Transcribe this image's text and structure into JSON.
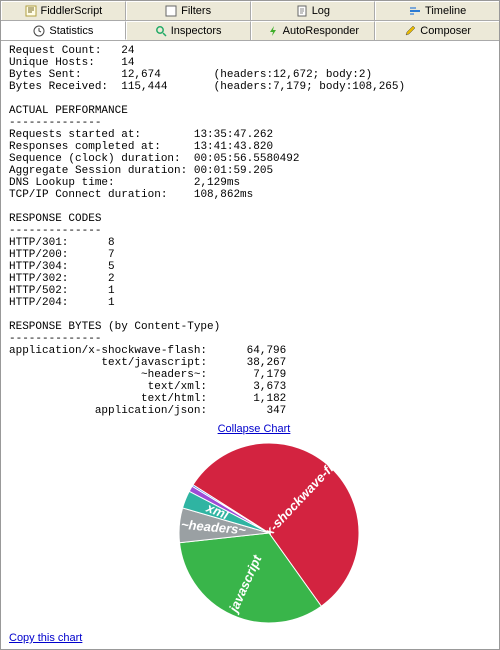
{
  "tabsTop": {
    "t0": "FiddlerScript",
    "t1": "Filters",
    "t2": "Log",
    "t3": "Timeline"
  },
  "tabsBottom": {
    "t0": "Statistics",
    "t1": "Inspectors",
    "t2": "AutoResponder",
    "t3": "Composer"
  },
  "summary": {
    "request_count_label": "Request Count:",
    "request_count": "24",
    "unique_hosts_label": "Unique Hosts:",
    "unique_hosts": "14",
    "bytes_sent_label": "Bytes Sent:",
    "bytes_sent": "12,674",
    "bytes_sent_breakdown": "(headers:12,672; body:2)",
    "bytes_recv_label": "Bytes Received:",
    "bytes_recv": "115,444",
    "bytes_recv_breakdown": "(headers:7,179; body:108,265)"
  },
  "perf": {
    "heading": "ACTUAL PERFORMANCE",
    "rule": "--------------",
    "req_start_label": "Requests started at:",
    "req_start": "13:35:47.262",
    "resp_done_label": "Responses completed at:",
    "resp_done": "13:41:43.820",
    "seq_label": "Sequence (clock) duration:",
    "seq": "00:05:56.5580492",
    "agg_label": "Aggregate Session duration:",
    "agg": "00:01:59.205",
    "dns_label": "DNS Lookup time:",
    "dns": "2,129ms",
    "tcp_label": "TCP/IP Connect duration:",
    "tcp": "108,862ms"
  },
  "codes": {
    "heading": "RESPONSE CODES",
    "rule": "--------------",
    "r301_label": "HTTP/301:",
    "r301": "8",
    "r200_label": "HTTP/200:",
    "r200": "7",
    "r304_label": "HTTP/304:",
    "r304": "5",
    "r302_label": "HTTP/302:",
    "r302": "2",
    "r502_label": "HTTP/502:",
    "r502": "1",
    "r204_label": "HTTP/204:",
    "r204": "1"
  },
  "bytes": {
    "heading": "RESPONSE BYTES (by Content-Type)",
    "rule": "--------------",
    "l0": "application/x-shockwave-flash:",
    "v0": "64,796",
    "l1": "text/javascript:",
    "v1": "38,267",
    "l2": "~headers~:",
    "v2": "7,179",
    "l3": "text/xml:",
    "v3": "3,673",
    "l4": "text/html:",
    "v4": "1,182",
    "l5": "application/json:",
    "v5": "347"
  },
  "links": {
    "collapse": "Collapse Chart",
    "copy": "Copy this chart"
  },
  "chart_data": {
    "type": "pie",
    "title": "",
    "series": [
      {
        "name": "x-shockwave-flash",
        "value": 64796,
        "color": "#d32340"
      },
      {
        "name": "javascript",
        "value": 38267,
        "color": "#39b54a"
      },
      {
        "name": "~headers~",
        "value": 7179,
        "color": "#9aa0a3"
      },
      {
        "name": "xml",
        "value": 3673,
        "color": "#2fb4a2"
      },
      {
        "name": "html",
        "value": 1182,
        "color": "#9e4bd6"
      },
      {
        "name": "json",
        "value": 347,
        "color": "#2563eb"
      }
    ],
    "labels_shown": [
      "x-shockwave-flash",
      "javascript",
      "~headers~",
      "xml"
    ]
  },
  "colors": {
    "link": "#0000cc",
    "tabbg": "#ece9d8"
  }
}
